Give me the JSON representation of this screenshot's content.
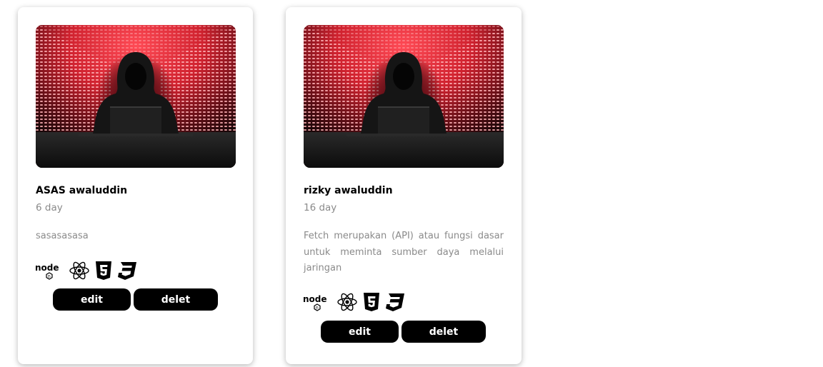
{
  "cards": [
    {
      "title": "ASAS awaluddin",
      "date": "6 day",
      "description": "sasasasasa",
      "technologies": [
        "nodejs-icon",
        "react-icon",
        "html5-icon",
        "css3-icon"
      ],
      "edit_label": "edit",
      "delete_label": "delet"
    },
    {
      "title": "rizky awaluddin",
      "date": "16 day",
      "description": "Fetch merupakan (API) atau fungsi dasar untuk meminta sumber daya melalui jaringan",
      "technologies": [
        "nodejs-icon",
        "react-icon",
        "html5-icon",
        "css3-icon"
      ],
      "edit_label": "edit",
      "delete_label": "delet"
    }
  ],
  "colors": {
    "button_bg": "#000000",
    "muted_text": "#8a8a8a",
    "image_accent": "#e8303c"
  }
}
